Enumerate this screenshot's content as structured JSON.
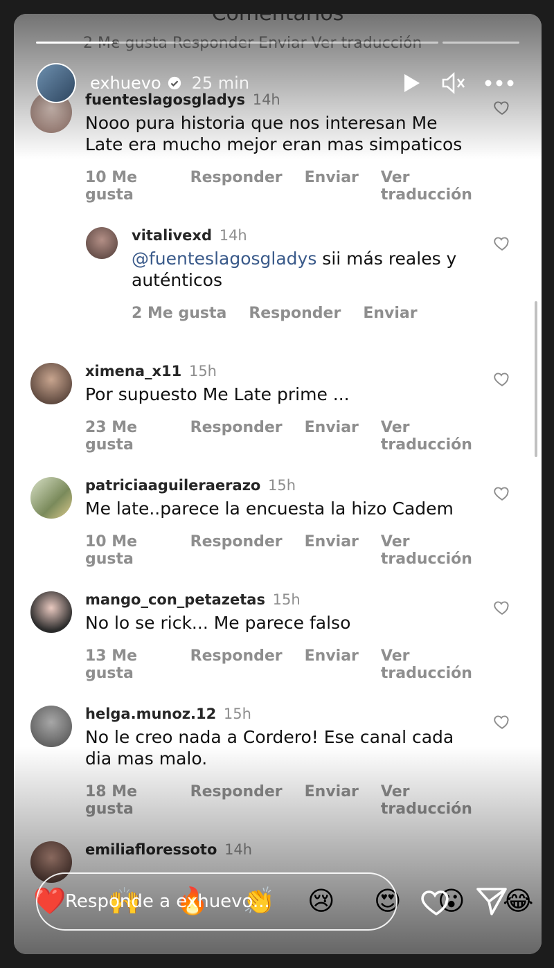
{
  "background_title": "Comentarios",
  "background_row": "2 Me gusta   Responder   Enviar   Ver traducción",
  "story": {
    "username": "exhuevo",
    "time": "25 min"
  },
  "comments": [
    {
      "user": "fuenteslagosgladys",
      "time": "14h",
      "text": "Nooo pura historia que nos interesan  Me Late era mucho mejor eran mas simpaticos",
      "likes": "10 Me gusta",
      "reply": "Responder",
      "send": "Enviar",
      "translate": "Ver traducción"
    },
    {
      "user": "vitalivexd",
      "time": "14h",
      "mention": "@fuenteslagosgladys",
      "text": " sii más reales y auténticos",
      "likes": "2 Me gusta",
      "reply": "Responder",
      "send": "Enviar"
    },
    {
      "user": "ximena_x11",
      "time": "15h",
      "text": "Por supuesto Me Late prime ...",
      "likes": "23 Me gusta",
      "reply": "Responder",
      "send": "Enviar",
      "translate": "Ver traducción"
    },
    {
      "user": "patriciaaguileraerazo",
      "time": "15h",
      "text": "Me late..parece la encuesta la hizo Cadem",
      "likes": "10 Me gusta",
      "reply": "Responder",
      "send": "Enviar",
      "translate": "Ver traducción"
    },
    {
      "user": "mango_con_petazetas",
      "time": "15h",
      "text": "No lo se rick... Me parece falso",
      "likes": "13 Me gusta",
      "reply": "Responder",
      "send": "Enviar",
      "translate": "Ver traducción"
    },
    {
      "user": "helga.munoz.12",
      "time": "15h",
      "text": "No le creo nada a Cordero! Ese canal cada dia mas malo.",
      "likes": "18 Me gusta",
      "reply": "Responder",
      "send": "Enviar",
      "translate": "Ver traducción"
    },
    {
      "user": "emiliafloressoto",
      "time": "14h"
    }
  ],
  "reply_placeholder": "Responde a exhuevo...",
  "quick_reactions": [
    "❤️",
    "🙌",
    "🔥",
    "👏",
    "😢",
    "😍",
    "😮",
    "😂"
  ],
  "icons": [
    "play-icon",
    "mute-icon",
    "more-icon",
    "verified-icon",
    "heart-icon",
    "send-icon",
    "like-story-icon"
  ],
  "colors": {
    "mention": "#3a5a8a",
    "meta_grey": "#8e8e8e",
    "story_bg": "#1c1c1c"
  }
}
